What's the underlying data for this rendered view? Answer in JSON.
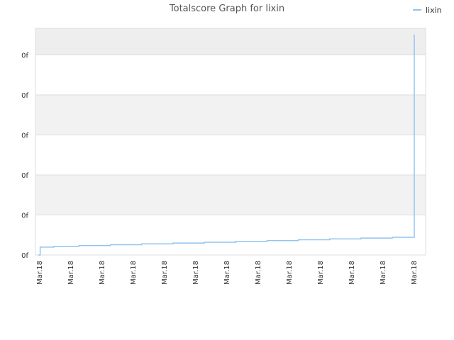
{
  "chart_data": {
    "type": "line",
    "title": "Totalscore Graph for lixin",
    "xlabel": "",
    "ylabel": "",
    "y_tick_labels": [
      "0f",
      "0f",
      "0f",
      "0f",
      "0f",
      "0f"
    ],
    "x_tick_labels": [
      "Mar.18",
      "Mar.18",
      "Mar.18",
      "Mar.18",
      "Mar.18",
      "Mar.18",
      "Mar.18",
      "Mar.18",
      "Mar.18",
      "Mar.18",
      "Mar.18",
      "Mar.18",
      "Mar.18"
    ],
    "ylim": [
      0,
      5.5
    ],
    "grid": true,
    "legend_position": "top-right",
    "series": [
      {
        "name": "lixin",
        "color": "#90c4f0",
        "x": [
          0,
          0.06,
          0.06,
          0.5,
          0.5,
          1.3,
          1.3,
          2.3,
          2.3,
          3.3,
          3.3,
          4.3,
          4.3,
          5.3,
          5.3,
          6.3,
          6.3,
          7.3,
          7.3,
          8.3,
          8.3,
          9.3,
          9.3,
          10.3,
          10.3,
          11.3,
          11.3,
          12.0,
          12.0,
          12.0,
          12.0
        ],
        "y": [
          0,
          0,
          0.19,
          0.19,
          0.21,
          0.21,
          0.23,
          0.23,
          0.25,
          0.25,
          0.27,
          0.27,
          0.29,
          0.29,
          0.31,
          0.31,
          0.33,
          0.33,
          0.35,
          0.35,
          0.37,
          0.37,
          0.39,
          0.39,
          0.41,
          0.41,
          0.43,
          0.43,
          1.4,
          3.8,
          5.35
        ]
      }
    ]
  }
}
